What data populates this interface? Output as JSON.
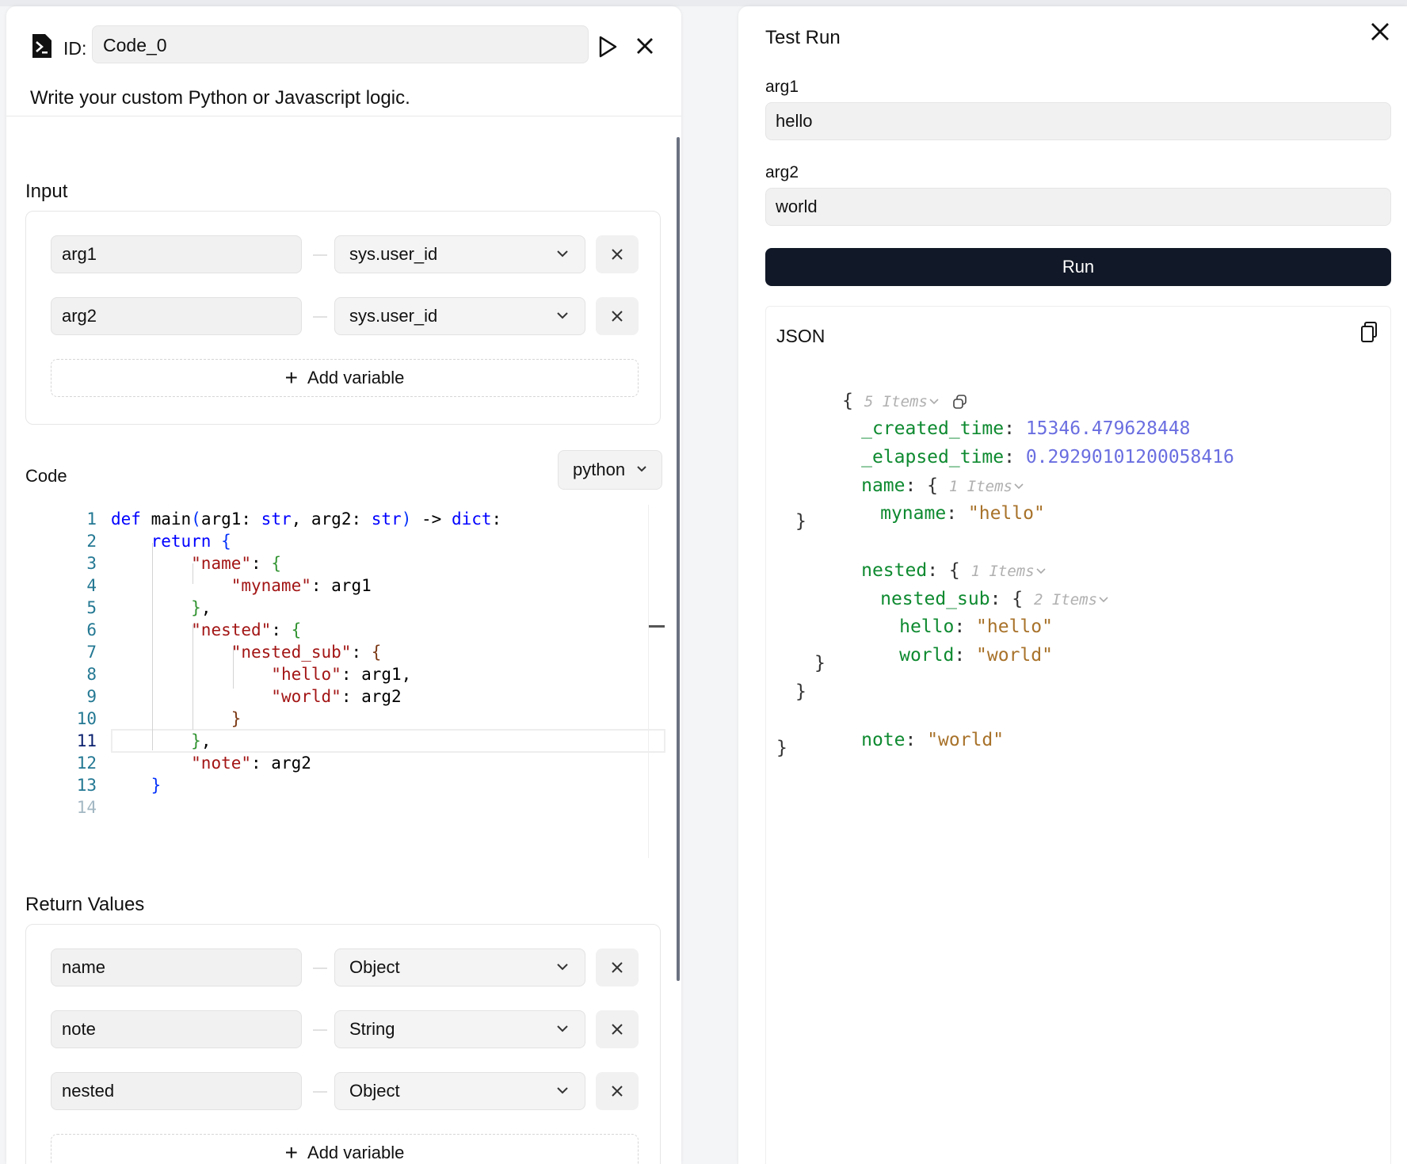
{
  "node": {
    "id_label": "ID:",
    "id_value": "Code_0",
    "description": "Write your custom Python or Javascript logic."
  },
  "input_section": {
    "title": "Input",
    "variables": [
      {
        "name": "arg1",
        "type": "sys.user_id"
      },
      {
        "name": "arg2",
        "type": "sys.user_id"
      }
    ],
    "add_label": "Add variable"
  },
  "code_section": {
    "title": "Code",
    "language": "python",
    "line_numbers": [
      "1",
      "2",
      "3",
      "4",
      "5",
      "6",
      "7",
      "8",
      "9",
      "10",
      "11",
      "12",
      "13",
      "14"
    ],
    "active_line": 11,
    "lines": [
      "def main(arg1: str, arg2: str) -> dict:",
      "    return {",
      "        \"name\": {",
      "            \"myname\": arg1",
      "        },",
      "        \"nested\": {",
      "            \"nested_sub\": {",
      "                \"hello\": arg1,",
      "                \"world\": arg2",
      "            }",
      "        },",
      "        \"note\": arg2",
      "    }",
      ""
    ]
  },
  "return_section": {
    "title": "Return Values",
    "variables": [
      {
        "name": "name",
        "type": "Object"
      },
      {
        "name": "note",
        "type": "String"
      },
      {
        "name": "nested",
        "type": "Object"
      }
    ],
    "add_label": "Add variable"
  },
  "test_run": {
    "title": "Test Run",
    "fields": [
      {
        "label": "arg1",
        "value": "hello"
      },
      {
        "label": "arg2",
        "value": "world"
      }
    ],
    "run_label": "Run",
    "json_label": "JSON",
    "json": {
      "root_count": "5 Items",
      "created_time_key": "_created_time",
      "created_time_value": "15346.479628448",
      "elapsed_time_key": "_elapsed_time",
      "elapsed_time_value": "0.29290101200058416",
      "name_key": "name",
      "name_count": "1 Items",
      "myname_key": "myname",
      "myname_value": "\"hello\"",
      "nested_key": "nested",
      "nested_count": "1 Items",
      "nested_sub_key": "nested_sub",
      "nested_sub_count": "2 Items",
      "hello_key": "hello",
      "hello_value": "\"hello\"",
      "world_key": "world",
      "world_value": "\"world\"",
      "note_key": "note",
      "note_value": "\"world\""
    }
  },
  "icons": {
    "node": "code-terminal-icon",
    "run": "play-icon",
    "close": "close-icon",
    "delete": "x-icon",
    "dropdown": "chevron-down-icon",
    "copy": "copy-icon",
    "add": "plus-icon"
  }
}
